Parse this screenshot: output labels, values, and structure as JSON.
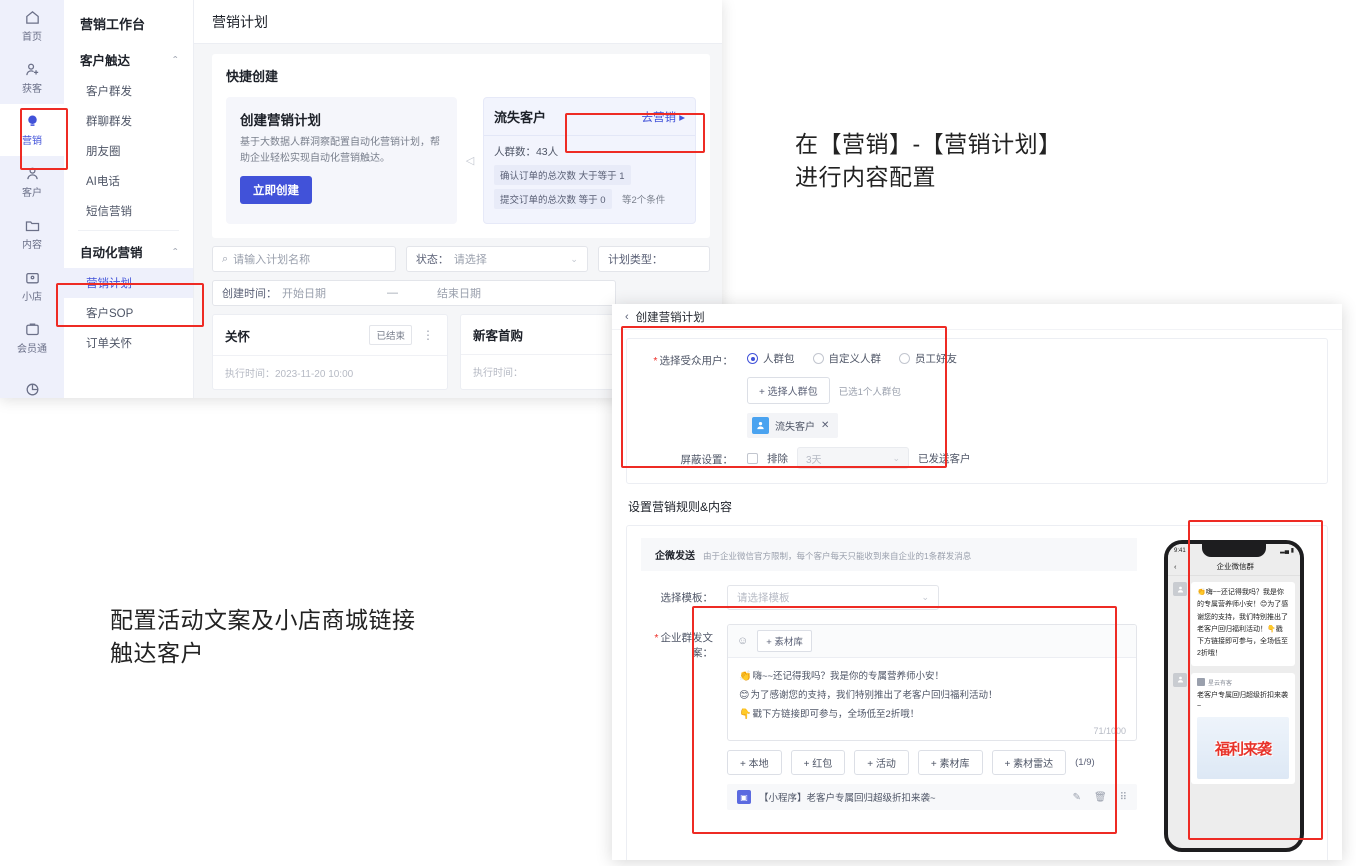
{
  "app": {
    "rail": [
      {
        "label": "首页",
        "icon": "home-icon",
        "active": false
      },
      {
        "label": "获客",
        "icon": "user-plus-icon",
        "active": false
      },
      {
        "label": "营销",
        "icon": "bulb-icon",
        "active": true
      },
      {
        "label": "客户",
        "icon": "user-icon",
        "active": false
      },
      {
        "label": "内容",
        "icon": "folder-icon",
        "active": false
      },
      {
        "label": "小店",
        "icon": "shop-icon",
        "active": false
      },
      {
        "label": "会员通",
        "icon": "card-icon",
        "active": false
      },
      {
        "label": "",
        "icon": "pie-chart-icon",
        "active": false
      }
    ],
    "nav": {
      "title": "营销工作台",
      "group1": "客户触达",
      "group1_items": [
        "客户群发",
        "群聊群发",
        "朋友圈",
        "AI电话",
        "短信营销"
      ],
      "group2": "自动化营销",
      "group2_items": [
        "营销计划",
        "客户SOP",
        "订单关怀"
      ],
      "active_item": "营销计划"
    },
    "header_title": "营销计划",
    "quick": {
      "section_title": "快捷创建",
      "create": {
        "title": "创建营销计划",
        "desc": "基于大数据人群洞察配置自动化营销计划，帮助企业轻松实现自动化营销触达。",
        "button": "立即创建"
      },
      "crowd": {
        "name": "流失客户",
        "action": "去营销",
        "count_label": "人群数：43人",
        "cond1": "确认订单的总次数 大于等于 1",
        "cond2": "提交订单的总次数 等于 0",
        "cond_extra": "等2个条件"
      }
    },
    "filters": {
      "search_placeholder": "请输入计划名称",
      "status_label": "状态：",
      "status_value": "请选择",
      "type_label": "计划类型：",
      "date_label": "创建时间：",
      "date_start": "开始日期",
      "date_sep": "—",
      "date_end": "结束日期"
    },
    "plans": [
      {
        "name": "关怀",
        "status": "已结束",
        "meta": "执行时间：2023-11-20 10:00"
      },
      {
        "name": "新客首购",
        "status": "",
        "meta": "执行时间："
      }
    ]
  },
  "notes": {
    "right": "在【营销】-【营销计划】\n进行内容配置",
    "left": "配置活动文案及小店商城链接\n触达客户"
  },
  "dialog": {
    "header_title": "创建营销计划",
    "audience": {
      "label": "选择受众用户：",
      "options": [
        "人群包",
        "自定义人群",
        "员工好友"
      ],
      "selected": "人群包",
      "pick_button": "+ 选择人群包",
      "pick_hint": "已选1个人群包",
      "chip": "流失客户",
      "shield_label": "屏蔽设置：",
      "exclude_label": "排除",
      "exclude_days": "3天",
      "exclude_suffix": "已发送客户"
    },
    "rules_title": "设置营销规则&内容",
    "wx": {
      "tag": "企微发送",
      "desc": "由于企业微信官方限制，每个客户每天只能收到来自企业的1条群发消息"
    },
    "template": {
      "label": "选择模板：",
      "placeholder": "请选择模板"
    },
    "message": {
      "label": "企业群发文案：",
      "emoji_icon": "emoji-icon",
      "material_button": "+ 素材库",
      "lines": [
        {
          "emoji": "👏",
          "text": "嗨~~还记得我吗？我是你的专属营养师小安！"
        },
        {
          "emoji": "😊",
          "text": "为了感谢您的支持，我们特别推出了老客户回归福利活动！"
        },
        {
          "emoji": "👇",
          "text": "戳下方链接即可参与，全场低至2折哦！"
        }
      ],
      "counter": "71/1000",
      "add_buttons": [
        "+ 本地",
        "+ 红包",
        "+ 活动",
        "+ 素材库",
        "+ 素材雷达"
      ],
      "add_count": "(1/9)",
      "attachment": "【小程序】老客户专属回归超级折扣来袭~"
    },
    "preview": {
      "status_time": "9:41",
      "status_right": "▂▄ ▮",
      "nav_title": "企业微信群",
      "bubble_text": "👏嗨~~还记得我吗？我是你的专属营养师小安！😊为了感谢您的支持，我们特别推出了老客户回归福利活动！👇戳下方链接即可参与，全场低至2折哦！",
      "card_source": "星云有客",
      "card_title": "老客户专属回归超级折扣来袭~",
      "card_image_text": "福利来袭"
    }
  },
  "colors": {
    "accent": "#4152d9",
    "callout": "#ee2b24",
    "rail_bg": "#eef0fb"
  }
}
